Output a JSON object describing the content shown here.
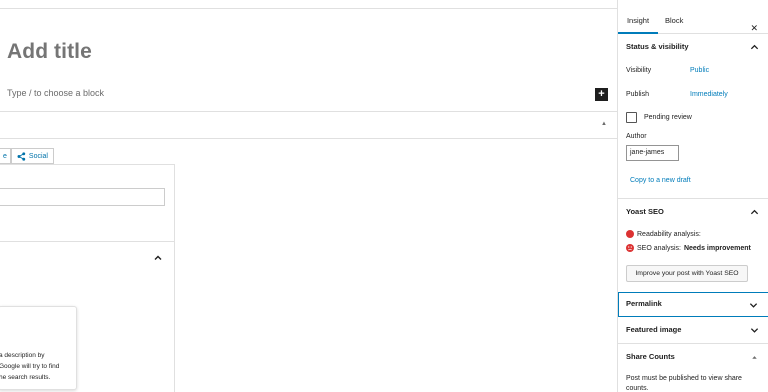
{
  "editor": {
    "title_placeholder": "Add title",
    "block_placeholder": "Type / to choose a block",
    "add_block_label": "+",
    "meta_toggle": "▲",
    "yoast_tabs": [
      {
        "label": "e"
      },
      {
        "label": "Social",
        "icon": "share-icon"
      }
    ],
    "snippet_preview_lines": [
      "a description by",
      "Google will try to find",
      "he search results."
    ]
  },
  "sidebar": {
    "tabs": [
      {
        "label": "Insight",
        "active": true
      },
      {
        "label": "Block",
        "active": false
      }
    ],
    "close_label": "✕",
    "status_panel": {
      "title": "Status & visibility",
      "visibility_label": "Visibility",
      "visibility_value": "Public",
      "publish_label": "Publish",
      "publish_value": "Immediately",
      "pending_review_label": "Pending review",
      "author_label": "Author",
      "author_value": "jane-james",
      "copy_draft_link": "Copy to a new draft"
    },
    "yoast_panel": {
      "title": "Yoast SEO",
      "readability_label": "Readability analysis:",
      "seo_label": "SEO analysis:",
      "seo_value": "Needs improvement",
      "improve_button": "Improve your post with Yoast SEO",
      "status_color": "#dc3232"
    },
    "permalink_panel": {
      "title": "Permalink"
    },
    "featured_image_panel": {
      "title": "Featured image"
    },
    "share_counts_panel": {
      "title": "Share Counts",
      "note": "Post must be published to view share counts."
    }
  },
  "colors": {
    "accent": "#007cba",
    "border": "#e0e0e0",
    "error": "#dc3232"
  }
}
